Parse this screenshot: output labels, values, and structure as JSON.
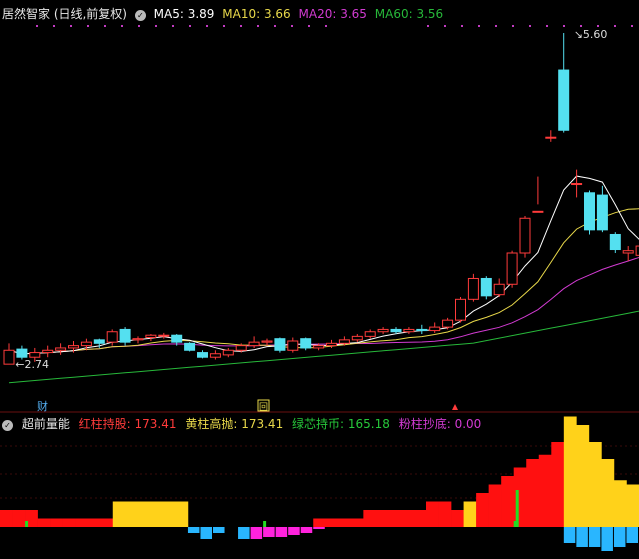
{
  "header": {
    "title": "居然智家 (日线,前复权)",
    "ma5": "MA5: 3.89",
    "ma10": "MA10: 3.66",
    "ma20": "MA20: 3.65",
    "ma60": "MA60: 3.56"
  },
  "indicator": {
    "name": "超前量能",
    "red": "红柱持股: 173.41",
    "yellow": "黄柱高抛: 173.41",
    "green": "绿芯持币: 165.18",
    "pink": "粉柱抄底: 0.00"
  },
  "markers": {
    "cai": "财",
    "box": "回"
  },
  "colors": {
    "up": "#ff3b3b",
    "down": "#54e0f0",
    "ma5": "#ffffff",
    "ma10": "#e8d84a",
    "ma20": "#d23bd2",
    "ma60": "#27b83a",
    "red_bar": "#ff1010",
    "yellow_bar": "#ffd21a",
    "cyan_bar": "#29b6ff",
    "pink_bar": "#ff22dd",
    "green_core": "#22dd22"
  },
  "chart_data": {
    "type": "candlestick",
    "annotations": [
      {
        "label": "2.74",
        "type": "low"
      },
      {
        "label": "5.60",
        "type": "high"
      }
    ],
    "candles": [
      {
        "o": 2.74,
        "c": 2.86,
        "h": 2.92,
        "l": 2.74
      },
      {
        "o": 2.87,
        "c": 2.8,
        "h": 2.9,
        "l": 2.78
      },
      {
        "o": 2.8,
        "c": 2.84,
        "h": 2.88,
        "l": 2.76
      },
      {
        "o": 2.84,
        "c": 2.86,
        "h": 2.9,
        "l": 2.8
      },
      {
        "o": 2.86,
        "c": 2.88,
        "h": 2.92,
        "l": 2.82
      },
      {
        "o": 2.88,
        "c": 2.9,
        "h": 2.94,
        "l": 2.84
      },
      {
        "o": 2.9,
        "c": 2.93,
        "h": 2.96,
        "l": 2.86
      },
      {
        "o": 2.95,
        "c": 2.92,
        "h": 2.96,
        "l": 2.88
      },
      {
        "o": 2.93,
        "c": 3.02,
        "h": 3.04,
        "l": 2.9
      },
      {
        "o": 3.04,
        "c": 2.93,
        "h": 3.06,
        "l": 2.9
      },
      {
        "o": 2.95,
        "c": 2.96,
        "h": 2.98,
        "l": 2.92
      },
      {
        "o": 2.97,
        "c": 2.99,
        "h": 3.0,
        "l": 2.94
      },
      {
        "o": 2.99,
        "c": 2.99,
        "h": 3.01,
        "l": 2.96
      },
      {
        "o": 2.99,
        "c": 2.93,
        "h": 3.0,
        "l": 2.9
      },
      {
        "o": 2.92,
        "c": 2.86,
        "h": 2.93,
        "l": 2.85
      },
      {
        "o": 2.84,
        "c": 2.8,
        "h": 2.86,
        "l": 2.79
      },
      {
        "o": 2.8,
        "c": 2.83,
        "h": 2.86,
        "l": 2.78
      },
      {
        "o": 2.82,
        "c": 2.86,
        "h": 2.88,
        "l": 2.8
      },
      {
        "o": 2.86,
        "c": 2.9,
        "h": 2.92,
        "l": 2.84
      },
      {
        "o": 2.9,
        "c": 2.93,
        "h": 2.98,
        "l": 2.88
      },
      {
        "o": 2.93,
        "c": 2.94,
        "h": 2.96,
        "l": 2.9
      },
      {
        "o": 2.96,
        "c": 2.86,
        "h": 2.97,
        "l": 2.84
      },
      {
        "o": 2.86,
        "c": 2.94,
        "h": 2.97,
        "l": 2.84
      },
      {
        "o": 2.96,
        "c": 2.88,
        "h": 2.97,
        "l": 2.86
      },
      {
        "o": 2.88,
        "c": 2.9,
        "h": 2.92,
        "l": 2.86
      },
      {
        "o": 2.9,
        "c": 2.92,
        "h": 2.95,
        "l": 2.88
      },
      {
        "o": 2.92,
        "c": 2.95,
        "h": 2.98,
        "l": 2.9
      },
      {
        "o": 2.95,
        "c": 2.98,
        "h": 3.0,
        "l": 2.93
      },
      {
        "o": 2.98,
        "c": 3.02,
        "h": 3.04,
        "l": 2.96
      },
      {
        "o": 3.02,
        "c": 3.04,
        "h": 3.06,
        "l": 3.0
      },
      {
        "o": 3.04,
        "c": 3.02,
        "h": 3.06,
        "l": 3.0
      },
      {
        "o": 3.02,
        "c": 3.04,
        "h": 3.06,
        "l": 3.0
      },
      {
        "o": 3.04,
        "c": 3.03,
        "h": 3.08,
        "l": 3.0
      },
      {
        "o": 3.03,
        "c": 3.06,
        "h": 3.1,
        "l": 3.01
      },
      {
        "o": 3.06,
        "c": 3.12,
        "h": 3.14,
        "l": 3.04
      },
      {
        "o": 3.12,
        "c": 3.3,
        "h": 3.32,
        "l": 3.1
      },
      {
        "o": 3.3,
        "c": 3.48,
        "h": 3.52,
        "l": 3.28
      },
      {
        "o": 3.48,
        "c": 3.33,
        "h": 3.5,
        "l": 3.3
      },
      {
        "o": 3.34,
        "c": 3.43,
        "h": 3.48,
        "l": 3.32
      },
      {
        "o": 3.43,
        "c": 3.7,
        "h": 3.72,
        "l": 3.4
      },
      {
        "o": 3.7,
        "c": 4.0,
        "h": 4.02,
        "l": 3.66
      },
      {
        "o": 4.06,
        "c": 4.06,
        "h": 4.36,
        "l": 4.12
      },
      {
        "o": 4.7,
        "c": 4.7,
        "h": 4.76,
        "l": 4.66
      },
      {
        "o": 5.28,
        "c": 4.76,
        "h": 5.6,
        "l": 4.74
      },
      {
        "o": 4.3,
        "c": 4.3,
        "h": 4.42,
        "l": 4.18
      },
      {
        "o": 4.22,
        "c": 3.9,
        "h": 4.24,
        "l": 3.86
      },
      {
        "o": 4.2,
        "c": 3.9,
        "h": 4.28,
        "l": 3.88
      },
      {
        "o": 3.86,
        "c": 3.73,
        "h": 3.88,
        "l": 3.7
      },
      {
        "o": 3.7,
        "c": 3.72,
        "h": 3.76,
        "l": 3.63
      },
      {
        "o": 3.68,
        "c": 3.76,
        "h": 3.78,
        "l": 3.52
      },
      {
        "o": 3.76,
        "c": 3.84,
        "h": 3.92,
        "l": 3.72
      }
    ],
    "indicator_bars": {
      "categories": [
        "d1",
        "d2",
        "d3",
        "d4",
        "d5",
        "d6",
        "d7",
        "d8",
        "d9",
        "d10",
        "d11",
        "d12",
        "d13",
        "d14",
        "d15",
        "d16",
        "d17",
        "d18",
        "d19",
        "d20",
        "d21",
        "d22",
        "d23",
        "d24",
        "d25",
        "d26",
        "d27",
        "d28",
        "d29",
        "d30",
        "d31",
        "d32",
        "d33",
        "d34",
        "d35",
        "d36",
        "d37",
        "d38",
        "d39",
        "d40",
        "d41",
        "d42",
        "d43",
        "d44",
        "d45",
        "d46",
        "d47",
        "d48",
        "d49",
        "d50",
        "d51"
      ],
      "values": [
        0.2,
        0.2,
        0.2,
        0.1,
        0.1,
        0.1,
        0.1,
        0.1,
        0.1,
        0.3,
        0.3,
        0.3,
        0.3,
        0.3,
        0.3,
        -0.1,
        -0.2,
        -0.2,
        -0.1,
        -0.3,
        -0.3,
        -0.2,
        -0.2,
        -0.2,
        -0.1,
        0.1,
        0.1,
        0.1,
        0.1,
        0.2,
        0.2,
        0.2,
        0.2,
        0.2,
        0.3,
        0.3,
        0.2,
        0.3,
        0.4,
        0.5,
        0.6,
        0.7,
        0.8,
        0.85,
        1.0,
        1.3,
        1.2,
        1.0,
        0.8,
        0.55,
        0.5
      ],
      "yellow": [
        0,
        0,
        0,
        0,
        0,
        0,
        0,
        0,
        0,
        0.3,
        0.3,
        0.3,
        0.3,
        0.3,
        0.3,
        0,
        0,
        0,
        0,
        0,
        0,
        0,
        0,
        0,
        0,
        0,
        0,
        0,
        0,
        0,
        0,
        0,
        0,
        0,
        0,
        0,
        0,
        0.4,
        0,
        0,
        0,
        0,
        0,
        0,
        0,
        1.3,
        1.2,
        1.0,
        0.8,
        0.55,
        0.5
      ],
      "below": [
        0,
        0,
        0,
        0,
        0,
        0,
        0,
        0,
        0,
        0,
        0,
        0,
        0,
        0,
        0,
        0.15,
        0.3,
        0.15,
        0.0,
        0.3,
        0.3,
        0.25,
        0.25,
        0.2,
        0.15,
        0.05,
        0,
        0,
        0,
        0,
        0,
        0,
        0,
        0,
        0,
        0,
        0,
        0,
        0,
        0,
        0,
        0,
        0,
        0,
        0,
        0.4,
        0.5,
        0.5,
        0.6,
        0.5,
        0.4
      ],
      "below_colors": [
        "pink",
        "cyan"
      ]
    }
  }
}
